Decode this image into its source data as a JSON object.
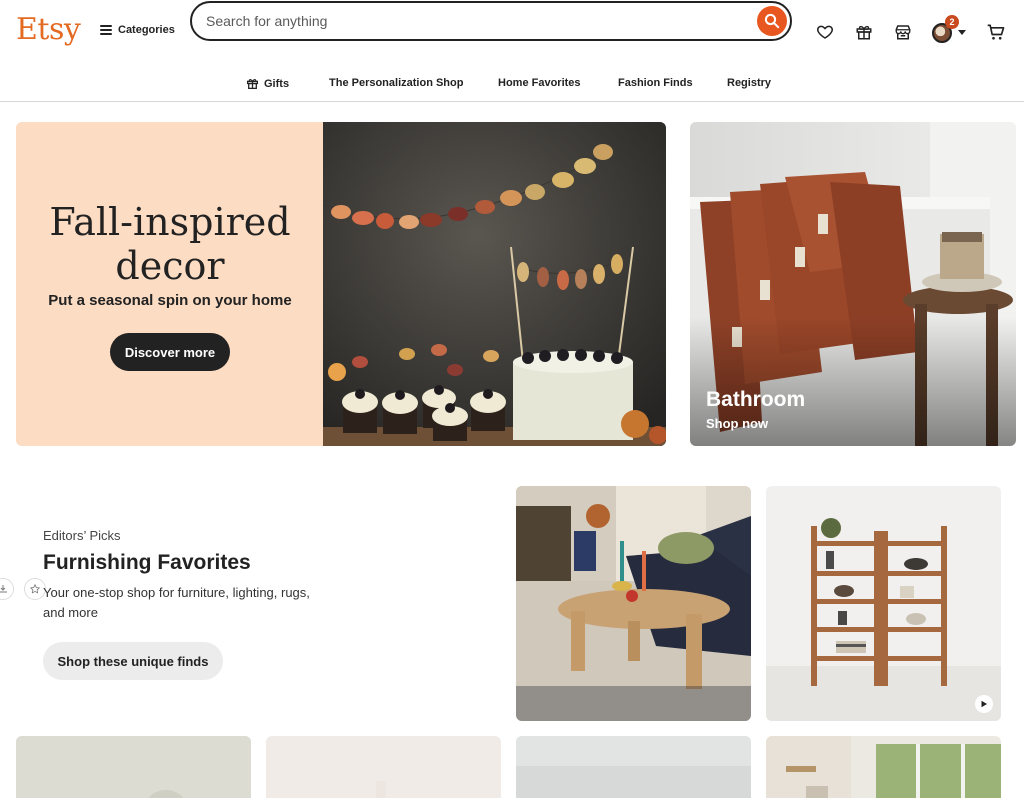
{
  "header": {
    "logo": "Etsy",
    "categories_label": "Categories",
    "search_placeholder": "Search for anything",
    "cart_badge_count": "2",
    "colors": {
      "brand": "#e36a21",
      "search_button": "#e8571f",
      "badge": "#c84a1e"
    },
    "icons": [
      "menu-icon",
      "search-icon",
      "heart-icon",
      "gift-icon",
      "shop-icon",
      "avatar",
      "cart-icon"
    ]
  },
  "subnav": {
    "items": [
      {
        "label": "Gifts",
        "icon": "gift-icon"
      },
      {
        "label": "The Personalization Shop"
      },
      {
        "label": "Home Favorites"
      },
      {
        "label": "Fashion Finds"
      },
      {
        "label": "Registry"
      }
    ]
  },
  "hero": {
    "title": "Fall-inspired decor",
    "subtitle": "Put a seasonal spin on your home",
    "button": "Discover more",
    "background": "#fcdcc3"
  },
  "bathroom": {
    "title": "Bathroom",
    "link": "Shop now"
  },
  "editors_picks": {
    "kicker": "Editors’ Picks",
    "title": "Furnishing Favorites",
    "description": "Your one-stop shop for furniture, lighting, rugs, and more",
    "button": "Shop these unique finds"
  }
}
